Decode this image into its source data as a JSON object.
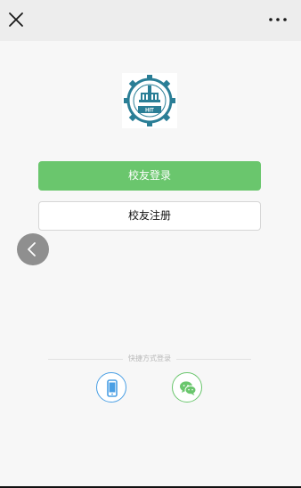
{
  "header": {
    "close_icon": "close-icon",
    "more_icon": "more-icon"
  },
  "logo": {
    "text": "HIT"
  },
  "buttons": {
    "login_label": "校友登录",
    "register_label": "校友注册"
  },
  "quick_login": {
    "label": "快捷方式登录",
    "options": [
      "phone-icon",
      "wechat-icon"
    ]
  },
  "colors": {
    "login_green": "#6ac66d",
    "phone_blue": "#4a9fe4",
    "logo_teal": "#2a7e96"
  }
}
